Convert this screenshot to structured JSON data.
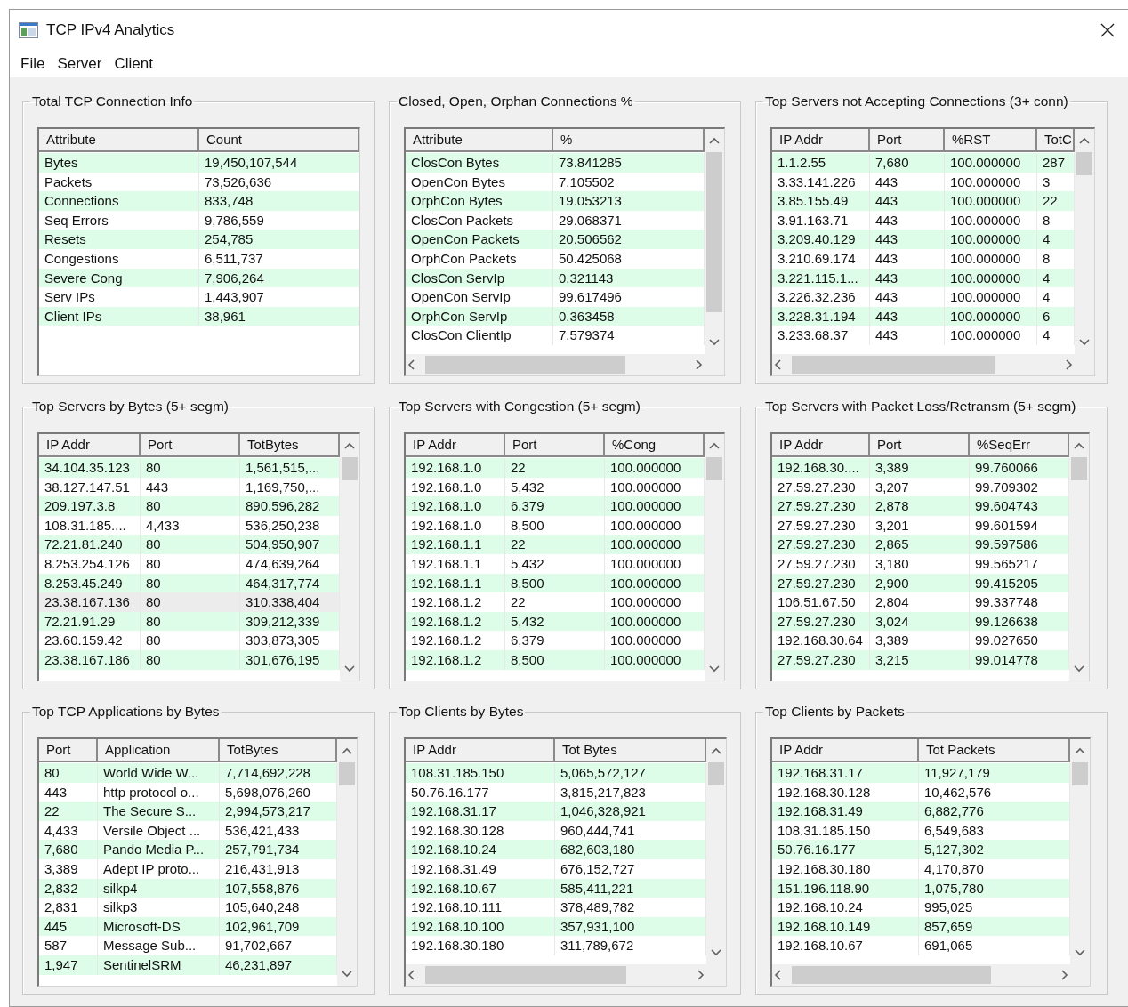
{
  "window": {
    "title": "TCP IPv4 Analytics"
  },
  "menu": [
    "File",
    "Server",
    "Client"
  ],
  "panels": [
    {
      "title": "Total TCP Connection Info",
      "columns": [
        "Attribute",
        "Count"
      ],
      "v_scroll": false,
      "h_scroll": false,
      "rows": [
        {
          "cells": [
            "Bytes",
            "19,450,107,544"
          ],
          "selected": false
        },
        {
          "cells": [
            "Packets",
            "73,526,636"
          ],
          "selected": false
        },
        {
          "cells": [
            "Connections",
            "833,748"
          ],
          "selected": false
        },
        {
          "cells": [
            "Seq Errors",
            "9,786,559"
          ],
          "selected": false
        },
        {
          "cells": [
            "Resets",
            "254,785"
          ],
          "selected": false
        },
        {
          "cells": [
            "Congestions",
            "6,511,737"
          ],
          "selected": false
        },
        {
          "cells": [
            "Severe Cong",
            "7,906,264"
          ],
          "selected": false
        },
        {
          "cells": [
            "Serv IPs",
            "1,443,907"
          ],
          "selected": false
        },
        {
          "cells": [
            "Client IPs",
            "38,961"
          ],
          "selected": false
        }
      ]
    },
    {
      "title": "Closed, Open, Orphan Connections %",
      "columns": [
        "Attribute",
        "%"
      ],
      "v_scroll": true,
      "h_scroll": true,
      "rows": [
        {
          "cells": [
            "ClosCon Bytes",
            "73.841285"
          ],
          "selected": false
        },
        {
          "cells": [
            "OpenCon Bytes",
            "7.105502"
          ],
          "selected": false
        },
        {
          "cells": [
            "OrphCon Bytes",
            "19.053213"
          ],
          "selected": false
        },
        {
          "cells": [
            "ClosCon Packets",
            "29.068371"
          ],
          "selected": false
        },
        {
          "cells": [
            "OpenCon Packets",
            "20.506562"
          ],
          "selected": false
        },
        {
          "cells": [
            "OrphCon Packets",
            "50.425068"
          ],
          "selected": false
        },
        {
          "cells": [
            "ClosCon ServIp",
            "0.321143"
          ],
          "selected": false
        },
        {
          "cells": [
            "OpenCon ServIp",
            "99.617496"
          ],
          "selected": false
        },
        {
          "cells": [
            "OrphCon ServIp",
            "0.363458"
          ],
          "selected": false
        },
        {
          "cells": [
            "ClosCon ClientIp",
            "7.579374"
          ],
          "selected": false
        }
      ]
    },
    {
      "title": "Top Servers not Accepting Connections (3+ conn)",
      "columns": [
        "IP Addr",
        "Port",
        "%RST",
        "TotC"
      ],
      "v_scroll": true,
      "h_scroll": true,
      "rows": [
        {
          "cells": [
            "1.1.2.55",
            "7,680",
            "100.000000",
            "287"
          ],
          "selected": false
        },
        {
          "cells": [
            "3.33.141.226",
            "443",
            "100.000000",
            "3"
          ],
          "selected": false
        },
        {
          "cells": [
            "3.85.155.49",
            "443",
            "100.000000",
            "22"
          ],
          "selected": false
        },
        {
          "cells": [
            "3.91.163.71",
            "443",
            "100.000000",
            "8"
          ],
          "selected": false
        },
        {
          "cells": [
            "3.209.40.129",
            "443",
            "100.000000",
            "4"
          ],
          "selected": false
        },
        {
          "cells": [
            "3.210.69.174",
            "443",
            "100.000000",
            "8"
          ],
          "selected": false
        },
        {
          "cells": [
            "3.221.115.1...",
            "443",
            "100.000000",
            "4"
          ],
          "selected": false
        },
        {
          "cells": [
            "3.226.32.236",
            "443",
            "100.000000",
            "4"
          ],
          "selected": false
        },
        {
          "cells": [
            "3.228.31.194",
            "443",
            "100.000000",
            "6"
          ],
          "selected": false
        },
        {
          "cells": [
            "3.233.68.37",
            "443",
            "100.000000",
            "4"
          ],
          "selected": false
        }
      ]
    },
    {
      "title": "Top Servers by Bytes (5+ segm)",
      "columns": [
        "IP Addr",
        "Port",
        "TotBytes"
      ],
      "v_scroll": true,
      "h_scroll": false,
      "rows": [
        {
          "cells": [
            "34.104.35.123",
            "80",
            "1,561,515,..."
          ],
          "selected": false
        },
        {
          "cells": [
            "38.127.147.51",
            "443",
            "1,169,750,..."
          ],
          "selected": false
        },
        {
          "cells": [
            "209.197.3.8",
            "80",
            "890,596,282"
          ],
          "selected": false
        },
        {
          "cells": [
            "108.31.185....",
            "4,433",
            "536,250,238"
          ],
          "selected": false
        },
        {
          "cells": [
            "72.21.81.240",
            "80",
            "504,950,907"
          ],
          "selected": false
        },
        {
          "cells": [
            "8.253.254.126",
            "80",
            "474,639,264"
          ],
          "selected": false
        },
        {
          "cells": [
            "8.253.45.249",
            "80",
            "464,317,774"
          ],
          "selected": false
        },
        {
          "cells": [
            "23.38.167.136",
            "80",
            "310,338,404"
          ],
          "selected": true
        },
        {
          "cells": [
            "72.21.91.29",
            "80",
            "309,212,339"
          ],
          "selected": false
        },
        {
          "cells": [
            "23.60.159.42",
            "80",
            "303,873,305"
          ],
          "selected": false
        },
        {
          "cells": [
            "23.38.167.186",
            "80",
            "301,676,195"
          ],
          "selected": false
        }
      ]
    },
    {
      "title": "Top Servers with Congestion  (5+ segm)",
      "columns": [
        "IP Addr",
        "Port",
        "%Cong"
      ],
      "v_scroll": true,
      "h_scroll": false,
      "rows": [
        {
          "cells": [
            "192.168.1.0",
            "22",
            "100.000000"
          ],
          "selected": false
        },
        {
          "cells": [
            "192.168.1.0",
            "5,432",
            "100.000000"
          ],
          "selected": false
        },
        {
          "cells": [
            "192.168.1.0",
            "6,379",
            "100.000000"
          ],
          "selected": false
        },
        {
          "cells": [
            "192.168.1.0",
            "8,500",
            "100.000000"
          ],
          "selected": false
        },
        {
          "cells": [
            "192.168.1.1",
            "22",
            "100.000000"
          ],
          "selected": false
        },
        {
          "cells": [
            "192.168.1.1",
            "5,432",
            "100.000000"
          ],
          "selected": false
        },
        {
          "cells": [
            "192.168.1.1",
            "8,500",
            "100.000000"
          ],
          "selected": false
        },
        {
          "cells": [
            "192.168.1.2",
            "22",
            "100.000000"
          ],
          "selected": false
        },
        {
          "cells": [
            "192.168.1.2",
            "5,432",
            "100.000000"
          ],
          "selected": false
        },
        {
          "cells": [
            "192.168.1.2",
            "6,379",
            "100.000000"
          ],
          "selected": false
        },
        {
          "cells": [
            "192.168.1.2",
            "8,500",
            "100.000000"
          ],
          "selected": false
        }
      ]
    },
    {
      "title": "Top Servers with Packet Loss/Retransm  (5+ segm)",
      "columns": [
        "IP Addr",
        "Port",
        "%SeqErr"
      ],
      "v_scroll": true,
      "h_scroll": false,
      "rows": [
        {
          "cells": [
            "192.168.30....",
            "3,389",
            "99.760066"
          ],
          "selected": false
        },
        {
          "cells": [
            "27.59.27.230",
            "3,207",
            "99.709302"
          ],
          "selected": false
        },
        {
          "cells": [
            "27.59.27.230",
            "2,878",
            "99.604743"
          ],
          "selected": false
        },
        {
          "cells": [
            "27.59.27.230",
            "3,201",
            "99.601594"
          ],
          "selected": false
        },
        {
          "cells": [
            "27.59.27.230",
            "2,865",
            "99.597586"
          ],
          "selected": false
        },
        {
          "cells": [
            "27.59.27.230",
            "3,180",
            "99.565217"
          ],
          "selected": false
        },
        {
          "cells": [
            "27.59.27.230",
            "2,900",
            "99.415205"
          ],
          "selected": false
        },
        {
          "cells": [
            "106.51.67.50",
            "2,804",
            "99.337748"
          ],
          "selected": false
        },
        {
          "cells": [
            "27.59.27.230",
            "3,024",
            "99.126638"
          ],
          "selected": false
        },
        {
          "cells": [
            "192.168.30.64",
            "3,389",
            "99.027650"
          ],
          "selected": false
        },
        {
          "cells": [
            "27.59.27.230",
            "3,215",
            "99.014778"
          ],
          "selected": false
        }
      ]
    },
    {
      "title": "Top TCP Applications by Bytes",
      "columns": [
        "Port",
        "Application",
        "TotBytes"
      ],
      "v_scroll": true,
      "h_scroll": false,
      "rows": [
        {
          "cells": [
            "80",
            "World Wide W...",
            "7,714,692,228"
          ],
          "selected": false
        },
        {
          "cells": [
            "443",
            "http protocol o...",
            "5,698,076,260"
          ],
          "selected": false
        },
        {
          "cells": [
            "22",
            "The Secure S...",
            "2,994,573,217"
          ],
          "selected": false
        },
        {
          "cells": [
            "4,433",
            "Versile Object ...",
            "536,421,433"
          ],
          "selected": false
        },
        {
          "cells": [
            "7,680",
            "Pando Media P...",
            "257,791,734"
          ],
          "selected": false
        },
        {
          "cells": [
            "3,389",
            "Adept IP proto...",
            "216,431,913"
          ],
          "selected": false
        },
        {
          "cells": [
            "2,832",
            "silkp4",
            "107,558,876"
          ],
          "selected": false
        },
        {
          "cells": [
            "2,831",
            "silkp3",
            "105,640,248"
          ],
          "selected": false
        },
        {
          "cells": [
            "445",
            "Microsoft-DS",
            "102,961,709"
          ],
          "selected": false
        },
        {
          "cells": [
            "587",
            "Message Sub...",
            "91,702,667"
          ],
          "selected": false
        },
        {
          "cells": [
            "1,947",
            "SentinelSRM",
            "46,231,897"
          ],
          "selected": false
        }
      ]
    },
    {
      "title": "Top Clients by Bytes",
      "columns": [
        "IP Addr",
        "Tot Bytes"
      ],
      "v_scroll": true,
      "h_scroll": true,
      "rows": [
        {
          "cells": [
            "108.31.185.150",
            "5,065,572,127"
          ],
          "selected": false
        },
        {
          "cells": [
            "50.76.16.177",
            "3,815,217,823"
          ],
          "selected": false
        },
        {
          "cells": [
            "192.168.31.17",
            "1,046,328,921"
          ],
          "selected": false
        },
        {
          "cells": [
            "192.168.30.128",
            "960,444,741"
          ],
          "selected": false
        },
        {
          "cells": [
            "192.168.10.24",
            "682,603,180"
          ],
          "selected": false
        },
        {
          "cells": [
            "192.168.31.49",
            "676,152,727"
          ],
          "selected": false
        },
        {
          "cells": [
            "192.168.10.67",
            "585,411,221"
          ],
          "selected": false
        },
        {
          "cells": [
            "192.168.10.111",
            "378,489,782"
          ],
          "selected": false
        },
        {
          "cells": [
            "192.168.10.100",
            "357,931,100"
          ],
          "selected": false
        },
        {
          "cells": [
            "192.168.30.180",
            "311,789,672"
          ],
          "selected": false
        }
      ]
    },
    {
      "title": "Top Clients by Packets",
      "columns": [
        "IP Addr",
        "Tot Packets"
      ],
      "v_scroll": true,
      "h_scroll": true,
      "rows": [
        {
          "cells": [
            "192.168.31.17",
            "11,927,179"
          ],
          "selected": false
        },
        {
          "cells": [
            "192.168.30.128",
            "10,462,576"
          ],
          "selected": false
        },
        {
          "cells": [
            "192.168.31.49",
            "6,882,776"
          ],
          "selected": false
        },
        {
          "cells": [
            "108.31.185.150",
            "6,549,683"
          ],
          "selected": false
        },
        {
          "cells": [
            "50.76.16.177",
            "5,127,302"
          ],
          "selected": false
        },
        {
          "cells": [
            "192.168.30.180",
            "4,170,870"
          ],
          "selected": false
        },
        {
          "cells": [
            "151.196.118.90",
            "1,075,780"
          ],
          "selected": false
        },
        {
          "cells": [
            "192.168.10.24",
            "995,025"
          ],
          "selected": false
        },
        {
          "cells": [
            "192.168.10.149",
            "857,659"
          ],
          "selected": false
        },
        {
          "cells": [
            "192.168.10.67",
            "691,065"
          ],
          "selected": false
        }
      ]
    }
  ]
}
